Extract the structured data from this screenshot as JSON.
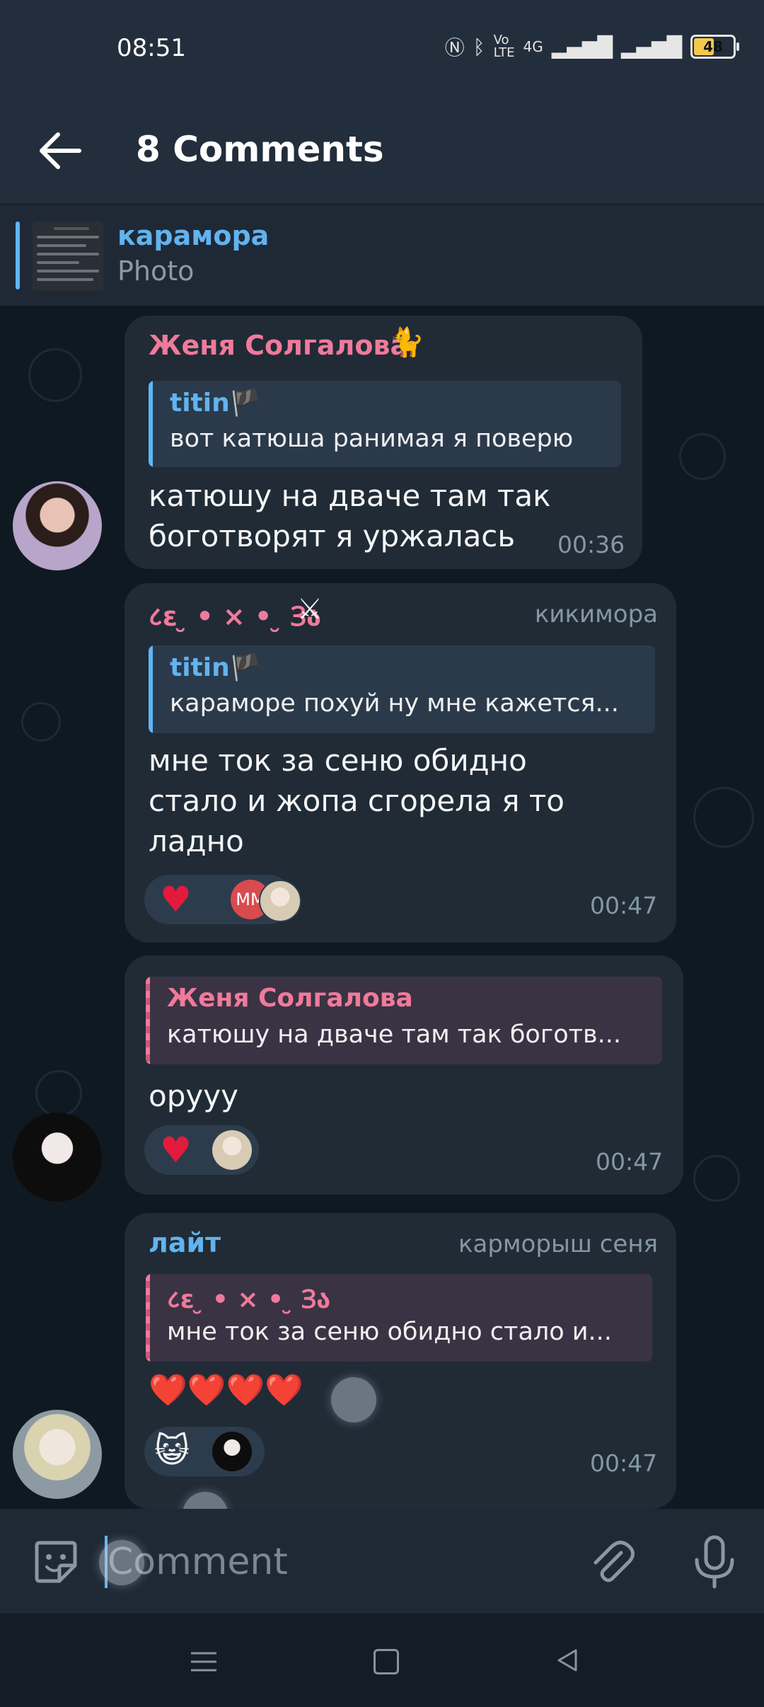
{
  "status": {
    "time": "08:51",
    "battery": "48",
    "network": "4G"
  },
  "header": {
    "title": "8 Comments"
  },
  "pinned": {
    "name": "карамора",
    "subtitle": "Photo"
  },
  "messages": [
    {
      "sender": "Женя Солгалова",
      "sender_color": "#f07a9b",
      "reply_name": "titin🏴",
      "reply_text": "вот катюша ранимая я поверю",
      "text_lines": [
        "катюшу на дваче там так",
        "боготворят я уржалась"
      ],
      "time": "00:36"
    },
    {
      "sender": "८ɛ ̮ • × • ̮ Ɜა",
      "sender_color": "#f07a9b",
      "role": "кикимора",
      "reply_name": "titin🏴",
      "reply_text": "караморе похуй ну мне кажется...",
      "text_lines": [
        "мне ток за сеню обидно",
        "стало и жопа сгорела я то",
        "ладно"
      ],
      "reaction_badge": "ММ",
      "time": "00:47"
    },
    {
      "reply_name": "Женя Солгалова",
      "reply_text": "катюшу на дваче там так боготв...",
      "text_lines": [
        "орууу"
      ],
      "time": "00:47"
    },
    {
      "sender": "лайт",
      "sender_color": "#62b3ee",
      "role": "карморыш сеня",
      "reply_name": "८ɛ ̮ • × • ̮ Ɜა",
      "reply_text": "мне ток за сеню обидно стало и...",
      "text_lines": [
        "❤️❤️❤️❤️"
      ],
      "time": "00:47"
    }
  ],
  "input": {
    "placeholder": "Comment"
  },
  "colors": {
    "accent": "#62b3ee",
    "pink": "#f07a9b",
    "heart": "#e21b3c",
    "bubble": "#202b36"
  }
}
